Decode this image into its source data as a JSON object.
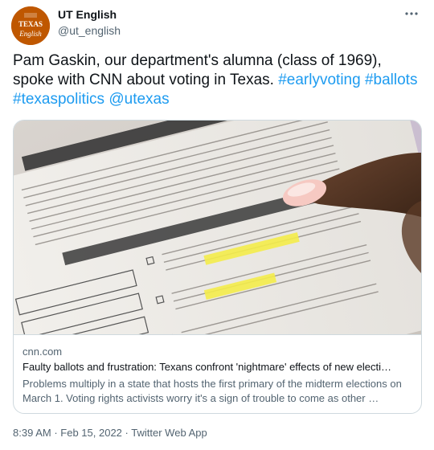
{
  "author": {
    "name": "UT English",
    "handle": "@ut_english",
    "avatar_text_top": "TEXAS",
    "avatar_text_bottom": "English",
    "avatar_color": "#bf5700"
  },
  "tweet": {
    "text": "Pam Gaskin, our department's alumna (class of 1969), spoke with CNN about voting in Texas.",
    "hashtags": [
      "#earlyvoting",
      "#ballots",
      "#texaspolitics"
    ],
    "mention": "@utexas"
  },
  "card": {
    "domain": "cnn.com",
    "title": "Faulty ballots and frustration: Texans confront 'nightmare' effects of new electi…",
    "description": "Problems multiply in a state that hosts the first primary of the midterm elections on March 1. Voting rights activists worry it's a sign of trouble to come as other …"
  },
  "meta": {
    "time": "8:39 AM",
    "separator": "·",
    "date": "Feb 15, 2022",
    "source": "Twitter Web App"
  },
  "icons": {
    "more": "more-horizontal-icon"
  },
  "colors": {
    "link": "#1d9bf0",
    "secondary_text": "#536471",
    "border": "#cfd9de"
  }
}
